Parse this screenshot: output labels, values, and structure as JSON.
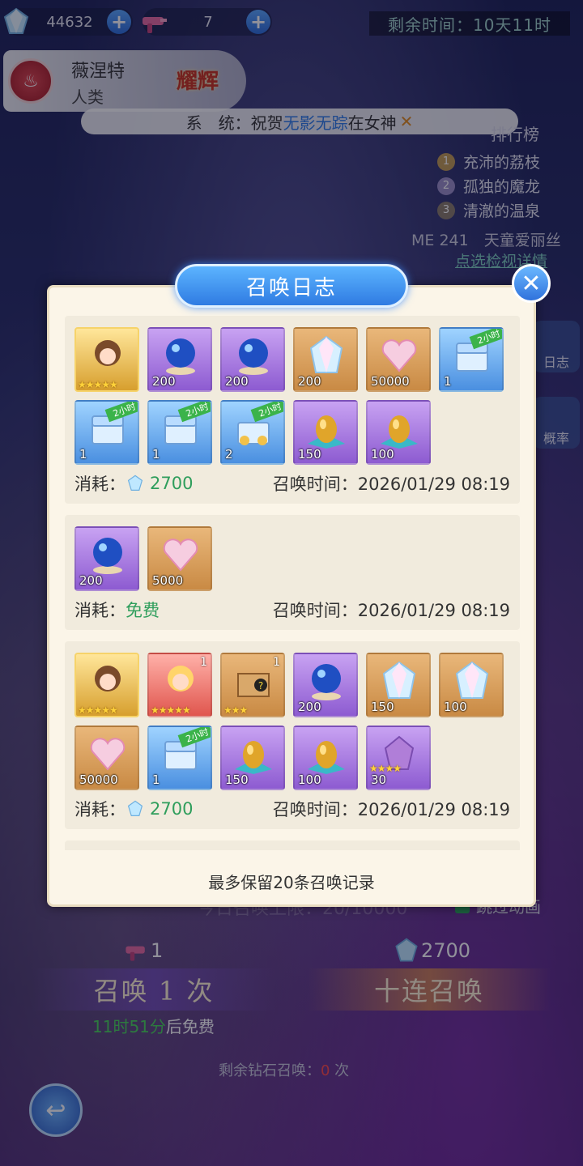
{
  "top": {
    "diamonds": "44632",
    "tickets": "7",
    "time_left_label": "剩余时间：10天11时"
  },
  "hero": {
    "name": "薇涅特",
    "race": "人类",
    "badge": "耀辉"
  },
  "system_bar": {
    "prefix": "系　统：祝贺",
    "player": "无影无踪",
    "suffix": "在女神"
  },
  "ranking": {
    "title": "排行榜",
    "items": [
      "充沛的荔枝",
      "孤独的魔龙",
      "清澈的温泉"
    ],
    "me": "ME 241　天童爱丽丝",
    "link": "点选检视详情"
  },
  "side_buttons": [
    "日志",
    "概率"
  ],
  "modal": {
    "title": "召唤日志",
    "close": "✕",
    "cost_label": "消耗：",
    "time_label": "召唤时间：",
    "footer": "最多保留20条召唤记录",
    "entries": [
      {
        "cost": "2700",
        "time": "2026/01/29 08:19",
        "items": [
          {
            "type": "hero",
            "color": "gold",
            "stars": "★★★★★",
            "qty": ""
          },
          {
            "type": "orb",
            "color": "purple",
            "qty": "200"
          },
          {
            "type": "orb",
            "color": "purple",
            "qty": "200"
          },
          {
            "type": "crystal",
            "color": "orange",
            "qty": "200"
          },
          {
            "type": "exp-heart",
            "color": "orange",
            "qty": "50000"
          },
          {
            "type": "chest",
            "color": "blue",
            "qty": "1",
            "tag": "2小时"
          },
          {
            "type": "chest",
            "color": "blue",
            "qty": "1",
            "tag": "2小时"
          },
          {
            "type": "chest",
            "color": "blue",
            "qty": "1",
            "tag": "2小时"
          },
          {
            "type": "gold-chest",
            "color": "blue",
            "qty": "2",
            "tag": "2小时"
          },
          {
            "type": "egg",
            "color": "purple",
            "qty": "150"
          },
          {
            "type": "egg",
            "color": "purple",
            "qty": "100"
          }
        ]
      },
      {
        "cost_free": "免费",
        "time": "2026/01/29 08:19",
        "items": [
          {
            "type": "orb",
            "color": "purple",
            "qty": "200"
          },
          {
            "type": "exp-heart",
            "color": "orange",
            "qty": "5000"
          }
        ]
      },
      {
        "cost": "2700",
        "time": "2026/01/29 08:19",
        "items": [
          {
            "type": "hero",
            "color": "gold",
            "stars": "★★★★★",
            "qty": ""
          },
          {
            "type": "hero2",
            "color": "red",
            "stars": "★★★★★",
            "lv": "1"
          },
          {
            "type": "mystery-box",
            "color": "orange",
            "stars": "★★★",
            "lv": "1"
          },
          {
            "type": "orb",
            "color": "purple",
            "qty": "200"
          },
          {
            "type": "crystal",
            "color": "orange",
            "qty": "150"
          },
          {
            "type": "crystal",
            "color": "orange",
            "qty": "100"
          },
          {
            "type": "exp-heart",
            "color": "orange",
            "qty": "50000"
          },
          {
            "type": "chest",
            "color": "blue",
            "qty": "1",
            "tag": "2小时"
          },
          {
            "type": "egg",
            "color": "purple",
            "qty": "150"
          },
          {
            "type": "egg",
            "color": "purple",
            "qty": "100"
          },
          {
            "type": "shard",
            "color": "purple",
            "qty": "30",
            "stars": "★★★★"
          }
        ]
      },
      {
        "partial": true,
        "items": [
          {
            "type": "weapon",
            "color": "orange"
          },
          {
            "type": "weapon",
            "color": "orange"
          },
          {
            "type": "orb",
            "color": "purple"
          },
          {
            "type": "orb",
            "color": "purple"
          },
          {
            "type": "crystal",
            "color": "orange"
          },
          {
            "type": "exp-heart",
            "color": "orange"
          }
        ]
      }
    ]
  },
  "bottom": {
    "limit_text": "今日召唤上限：20/10000",
    "skip_anim": "跳过动画",
    "single_cost": "1",
    "ten_cost": "2700",
    "single_label": "召唤 1 次",
    "ten_label": "十连召唤",
    "free_time": "11时51分",
    "free_suffix": "后免费",
    "remaining_prefix": "剩余钻石召唤：",
    "remaining_count": "0",
    "remaining_suffix": " 次"
  },
  "colors": {
    "accent_blue": "#2f7be2",
    "cost_green": "#2f9e5c",
    "highlight_blue": "#2c7ae8",
    "free_green": "#4ad35a"
  }
}
